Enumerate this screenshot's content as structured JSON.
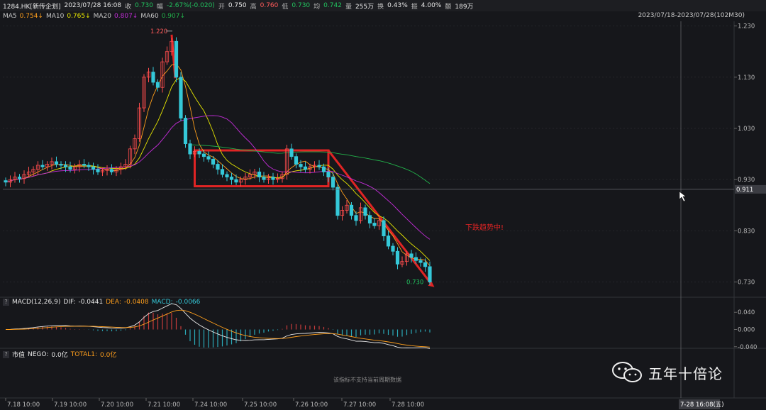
{
  "info": {
    "code": "1284.HK[新传企划]",
    "datetime": "2023/07/28 16:08",
    "close_label": "收",
    "close": "0.730",
    "change_label": "幅",
    "change": "-2.67%(-0.020)",
    "open_label": "开",
    "open": "0.750",
    "high_label": "高",
    "high": "0.760",
    "low_label": "低",
    "low": "0.730",
    "avg_label": "均",
    "avg": "0.742",
    "vol_label": "量",
    "vol": "255万",
    "turnover_label": "换",
    "turnover": "0.43%",
    "amp_label": "振",
    "amp": "4.00%",
    "amount_label": "额",
    "amount": "189万"
  },
  "ma": [
    {
      "name": "MA5",
      "value": "0.754↓",
      "color": "#ff9f1c"
    },
    {
      "name": "MA10",
      "value": "0.765↓",
      "color": "#e6e600"
    },
    {
      "name": "MA20",
      "value": "0.807↓",
      "color": "#c32cd8"
    },
    {
      "name": "MA60",
      "value": "0.907↓",
      "color": "#22b04a"
    }
  ],
  "range": "2023/07/18-2023/07/28(102M30)",
  "macd_pane": {
    "q": "?",
    "name": "MACD(12,26,9)",
    "dif_label": "DIF:",
    "dif": "-0.0441",
    "dea_label": "DEA:",
    "dea": "-0.0408",
    "macd_label": "MACD:",
    "macd": "-0.0066"
  },
  "cap_pane": {
    "q": "?",
    "name": "市值",
    "nego_label": "NEGO:",
    "nego": "0.0亿",
    "total_label": "TOTAL1:",
    "total": "0.0亿",
    "no_data": "该指标不支持当前周期数据"
  },
  "watermark": "五年十倍论",
  "chart_data": {
    "type": "candlestick",
    "price_ylim": [
      0.71,
      1.235
    ],
    "price_ticks": [
      "1.230",
      "1.130",
      "1.030",
      "0.930",
      "0.830",
      "0.730"
    ],
    "macd_ylim": [
      -0.047,
      0.047
    ],
    "macd_ticks": [
      "0.040",
      "0.000",
      "-0.040"
    ],
    "x_ticks": [
      "7.18 10:00",
      "7.19 10:00",
      "7.20 10:00",
      "7.21 10:00",
      "7.24 10:00",
      "7.25 10:00",
      "7.26 10:00",
      "7.27 10:00",
      "7.28 10:00"
    ],
    "crosshair_price": "0.911",
    "crosshair_time": "7-28 16:08(五)",
    "high_annotation": "1.220",
    "low_annotation": "0.730",
    "trend_annotation": "下跌趋势中!",
    "consolidation_box": {
      "x_start": 41,
      "x_end": 70,
      "y_low": 0.917,
      "y_high": 0.987
    },
    "trend_line": {
      "from": {
        "x": 36,
        "y": 1.213
      },
      "to": {
        "x": 93,
        "y": 0.72
      }
    },
    "close": [
      0.925,
      0.93,
      0.935,
      0.932,
      0.94,
      0.945,
      0.95,
      0.958,
      0.955,
      0.96,
      0.965,
      0.96,
      0.958,
      0.955,
      0.95,
      0.955,
      0.96,
      0.958,
      0.955,
      0.95,
      0.945,
      0.948,
      0.95,
      0.945,
      0.95,
      0.955,
      0.96,
      0.99,
      1.01,
      1.07,
      1.13,
      1.14,
      1.12,
      1.11,
      1.16,
      1.18,
      1.2,
      1.13,
      1.05,
      1.0,
      0.98,
      0.985,
      0.98,
      0.975,
      0.97,
      0.96,
      0.95,
      0.94,
      0.935,
      0.93,
      0.925,
      0.93,
      0.935,
      0.94,
      0.945,
      0.935,
      0.93,
      0.935,
      0.93,
      0.932,
      0.94,
      0.99,
      0.975,
      0.96,
      0.955,
      0.95,
      0.955,
      0.958,
      0.955,
      0.945,
      0.935,
      0.915,
      0.86,
      0.87,
      0.88,
      0.86,
      0.85,
      0.875,
      0.86,
      0.845,
      0.84,
      0.85,
      0.82,
      0.8,
      0.79,
      0.765,
      0.77,
      0.785,
      0.778,
      0.772,
      0.768,
      0.76,
      0.73
    ]
  }
}
